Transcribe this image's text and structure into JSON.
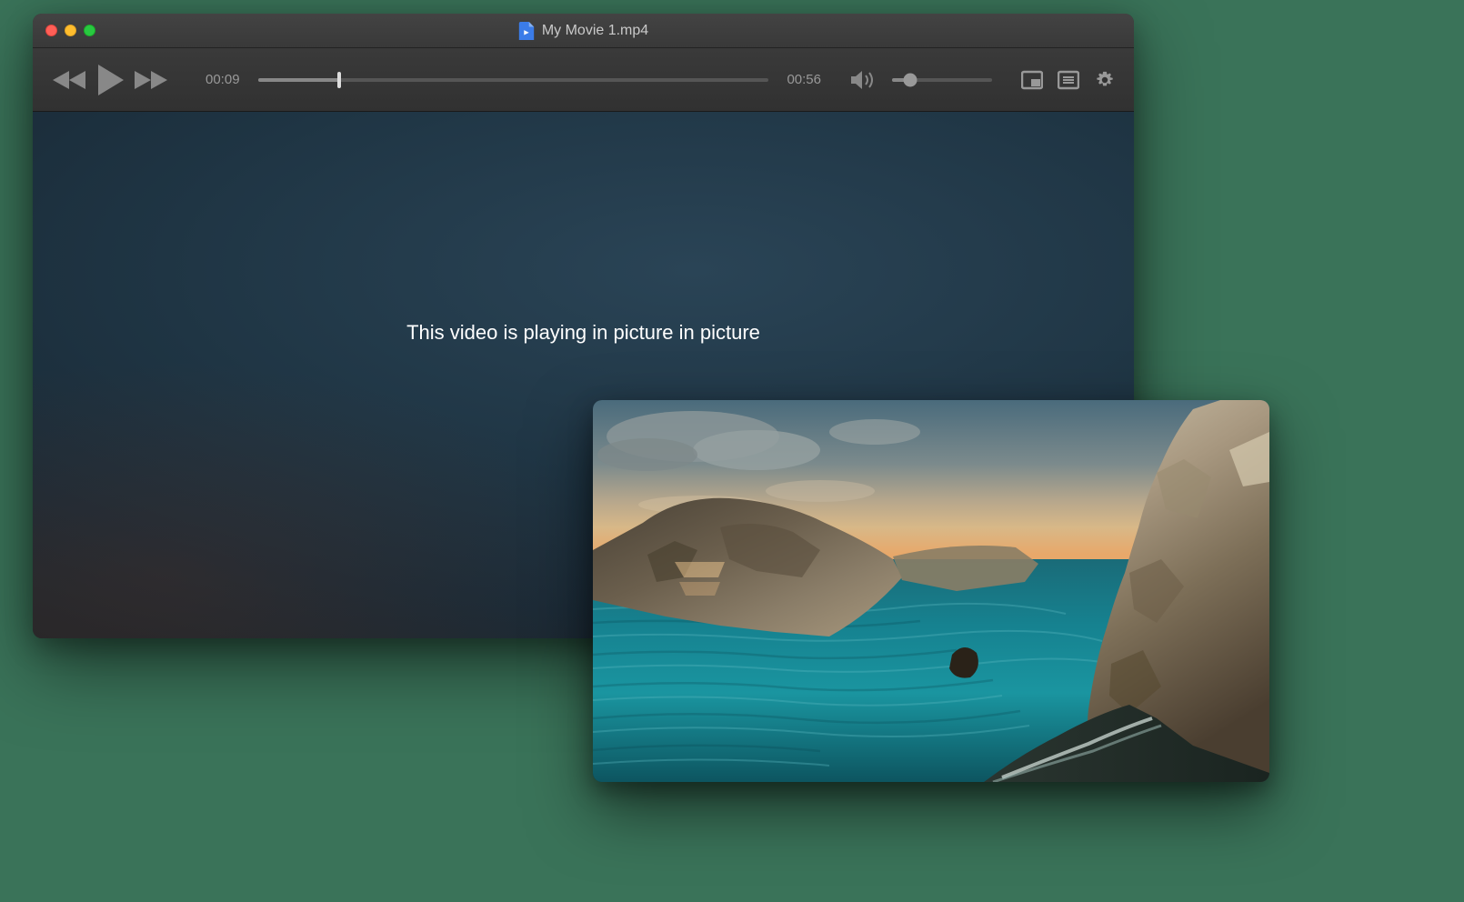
{
  "window": {
    "title": "My Movie 1.mp4"
  },
  "player": {
    "elapsed": "00:09",
    "duration": "00:56",
    "progress_percent": 16,
    "volume_percent": 18,
    "pip_message": "This video is playing in picture in picture"
  }
}
